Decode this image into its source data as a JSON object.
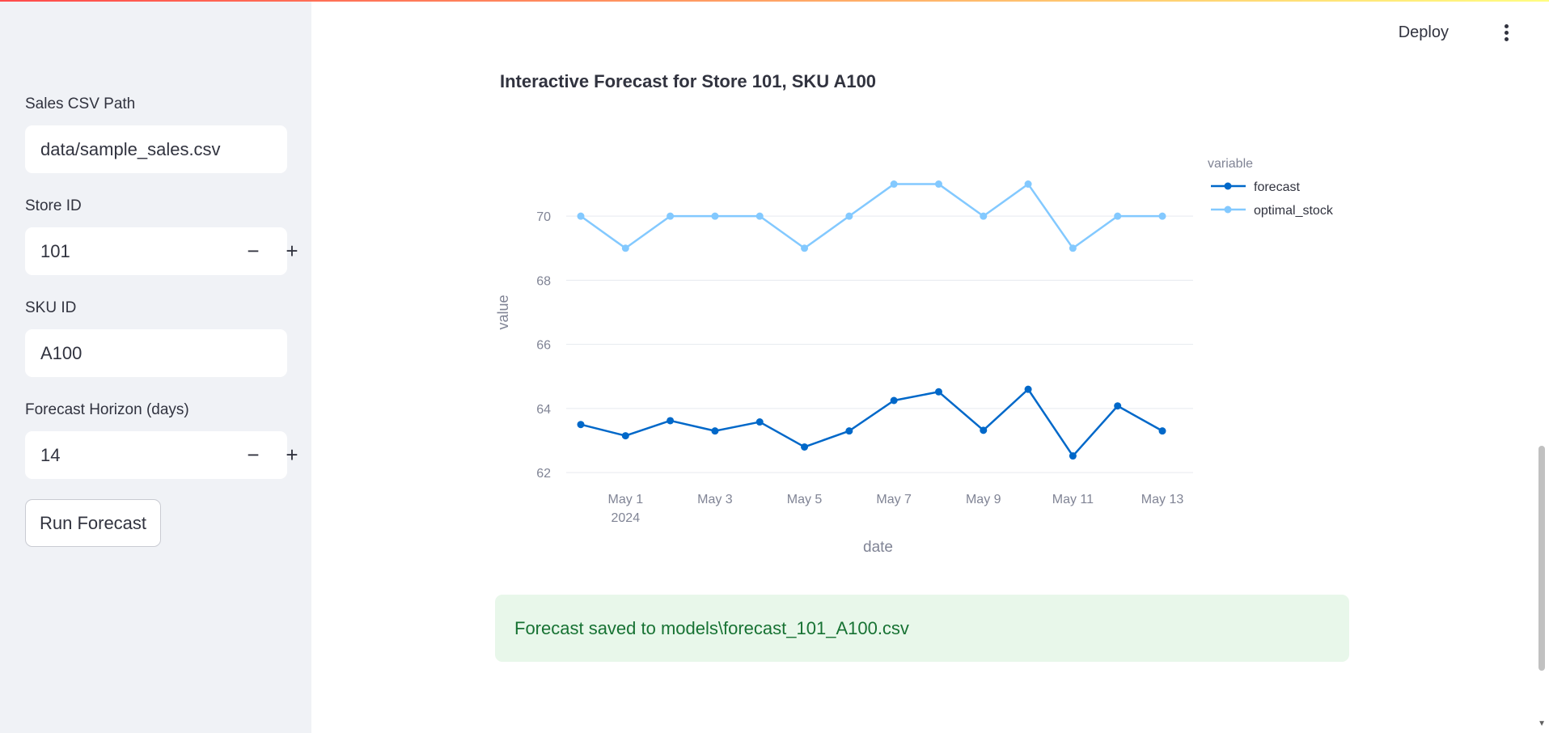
{
  "sidebar": {
    "csv_path_label": "Sales CSV Path",
    "csv_path_value": "data/sample_sales.csv",
    "store_id_label": "Store ID",
    "store_id_value": "101",
    "sku_id_label": "SKU ID",
    "sku_id_value": "A100",
    "horizon_label": "Forecast Horizon (days)",
    "horizon_value": "14",
    "minus_symbol": "−",
    "plus_symbol": "+",
    "run_button_label": "Run Forecast"
  },
  "header": {
    "deploy_label": "Deploy",
    "menu_icon": "kebab-menu-icon"
  },
  "main": {
    "chart_title": "Interactive Forecast for Store 101, SKU A100",
    "success_message": "Forecast saved to models\\forecast_101_A100.csv"
  },
  "colors": {
    "forecast": "#0068c9",
    "optimal_stock": "#83c9ff",
    "success_bg": "#e8f7ea",
    "success_text": "#177233",
    "sidebar_bg": "#f0f2f6"
  },
  "chart_data": {
    "type": "line",
    "xlabel": "date",
    "ylabel": "value",
    "legend_title": "variable",
    "legend_placement": "top-right",
    "grid": true,
    "x": [
      "2024-04-30",
      "2024-05-01",
      "2024-05-02",
      "2024-05-03",
      "2024-05-04",
      "2024-05-05",
      "2024-05-06",
      "2024-05-07",
      "2024-05-08",
      "2024-05-09",
      "2024-05-10",
      "2024-05-11",
      "2024-05-12",
      "2024-05-13"
    ],
    "x_ticks": [
      {
        "date": "2024-05-01",
        "label": "May 1",
        "sublabel": "2024"
      },
      {
        "date": "2024-05-03",
        "label": "May 3",
        "sublabel": ""
      },
      {
        "date": "2024-05-05",
        "label": "May 5",
        "sublabel": ""
      },
      {
        "date": "2024-05-07",
        "label": "May 7",
        "sublabel": ""
      },
      {
        "date": "2024-05-09",
        "label": "May 9",
        "sublabel": ""
      },
      {
        "date": "2024-05-11",
        "label": "May 11",
        "sublabel": ""
      },
      {
        "date": "2024-05-13",
        "label": "May 13",
        "sublabel": ""
      }
    ],
    "y_ticks": [
      62,
      64,
      66,
      68,
      70
    ],
    "ylim": [
      61.6,
      72.2
    ],
    "series": [
      {
        "name": "forecast",
        "values": [
          63.5,
          63.15,
          63.62,
          63.3,
          63.58,
          62.8,
          63.3,
          64.25,
          64.52,
          63.32,
          64.6,
          62.52,
          64.08,
          63.3
        ]
      },
      {
        "name": "optimal_stock",
        "values": [
          70,
          69,
          70,
          70,
          70,
          69,
          70,
          71,
          71,
          70,
          71,
          69,
          70,
          70
        ]
      }
    ]
  }
}
